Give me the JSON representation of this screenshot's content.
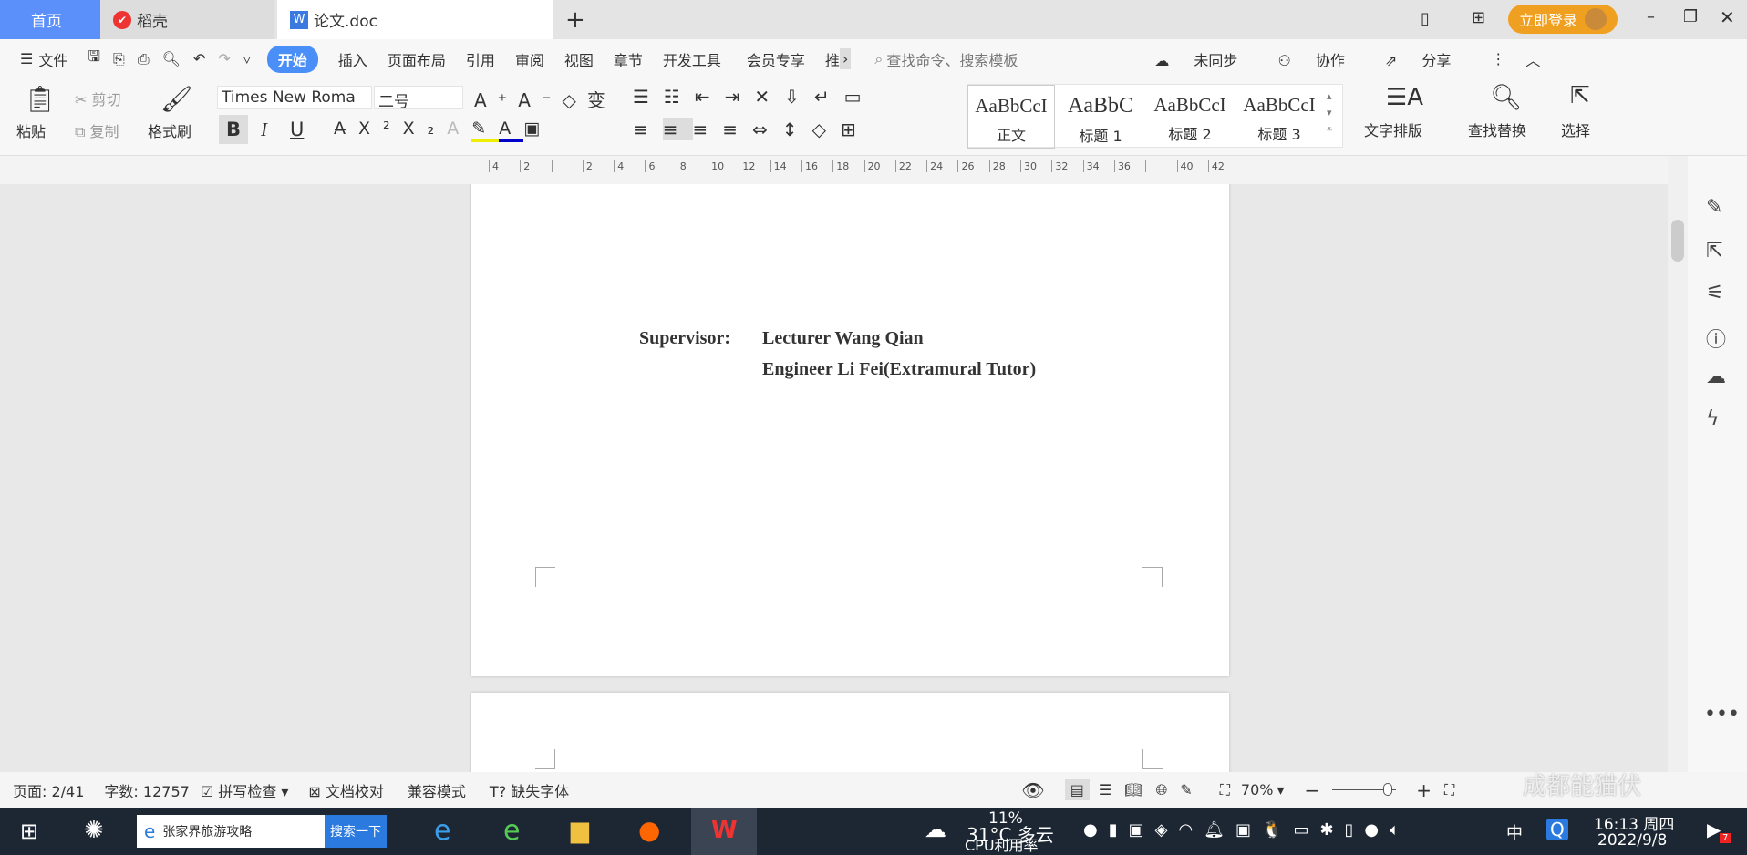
{
  "tabs": {
    "home": "首页",
    "daoke": "稻壳",
    "doc": "论文.doc",
    "add": "+",
    "login": "立即登录"
  },
  "menu": {
    "file": "文件",
    "items": [
      "开始",
      "插入",
      "页面布局",
      "引用",
      "审阅",
      "视图",
      "章节",
      "开发工具",
      "会员专享",
      "推"
    ],
    "search_placeholder": "查找命令、搜索模板",
    "sync": "未同步",
    "collab": "协作",
    "share": "分享"
  },
  "toolbar": {
    "paste": "粘贴",
    "cut": "剪切",
    "copy": "复制",
    "format_painter": "格式刷",
    "font": "Times New Roma",
    "size": "二号",
    "bold": "B",
    "italic": "I",
    "underline": "U",
    "styles": [
      {
        "sample": "AaBbCcI",
        "label": "正文"
      },
      {
        "sample": "AaBbC",
        "label": "标题 1"
      },
      {
        "sample": "AaBbCcI",
        "label": "标题 2"
      },
      {
        "sample": "AaBbCcI",
        "label": "标题 3"
      }
    ],
    "text_layout": "文字排版",
    "find_replace": "查找替换",
    "select": "选择"
  },
  "ruler": {
    "ticks": [
      "4",
      "2",
      "",
      "2",
      "4",
      "6",
      "8",
      "10",
      "12",
      "14",
      "16",
      "18",
      "20",
      "22",
      "24",
      "26",
      "28",
      "30",
      "32",
      "34",
      "36",
      "",
      "40",
      "42"
    ]
  },
  "document": {
    "supervisor_label": "Supervisor:",
    "supervisor_1": "Lecturer Wang Qian",
    "supervisor_2": "Engineer Li Fei(Extramural Tutor)"
  },
  "status": {
    "page": "页面: 2/41",
    "words": "字数: 12757",
    "spell": "拼写检查",
    "proof": "文档校对",
    "compat": "兼容模式",
    "missing_font": "缺失字体",
    "zoom": "70%"
  },
  "taskbar": {
    "search_text": "张家界旅游攻略",
    "search_btn": "搜索一下",
    "weather": "31°C 多云",
    "cpu": "11%",
    "cpu_label": "CPU利用率",
    "ime": "中",
    "time": "16:13 周四",
    "date": "2022/9/8",
    "notif_count": "7",
    "watermark": "成都能猫伏"
  }
}
